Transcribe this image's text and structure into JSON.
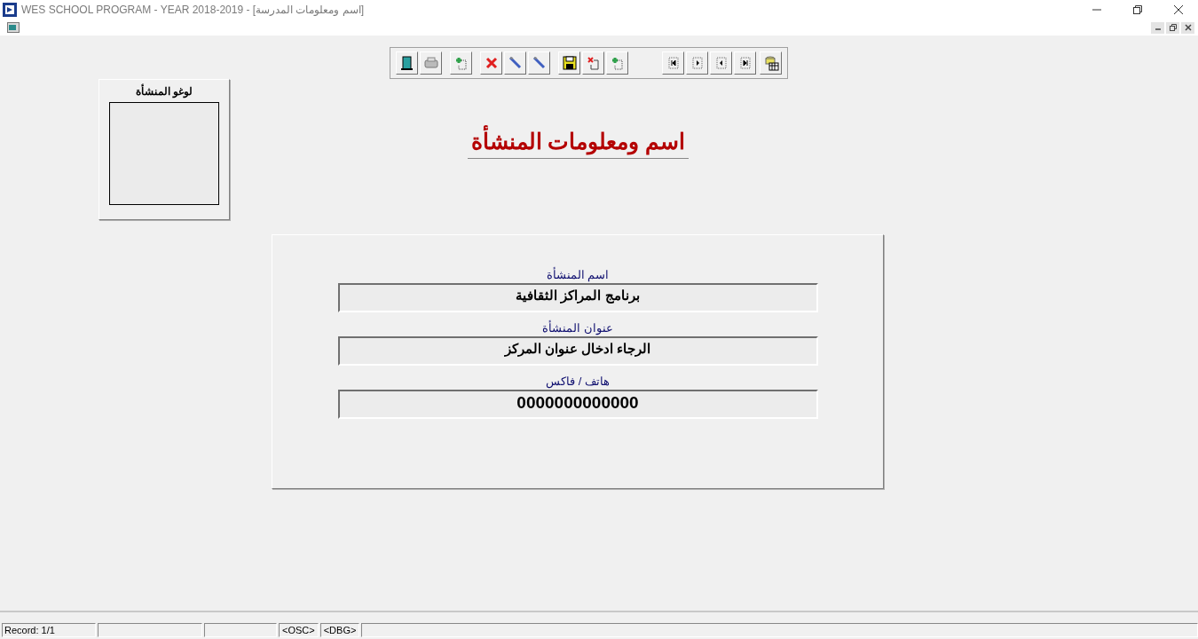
{
  "window": {
    "title": "WES SCHOOL PROGRAM - YEAR 2018-2019 - [اسم ومعلومات المدرسة]"
  },
  "toolbar": {
    "groups": [
      {
        "buttons": [
          {
            "kind": "exit"
          },
          {
            "kind": "print"
          }
        ]
      },
      {
        "buttons": [
          {
            "kind": "add"
          }
        ]
      },
      {
        "buttons": [
          {
            "kind": "delete"
          },
          {
            "kind": "edit"
          },
          {
            "kind": "edit-alt"
          }
        ]
      },
      {
        "buttons": [
          {
            "kind": "save"
          },
          {
            "kind": "cancel"
          },
          {
            "kind": "new"
          }
        ]
      },
      {
        "buttons": [
          {
            "kind": "first"
          },
          {
            "kind": "next"
          },
          {
            "kind": "prev"
          },
          {
            "kind": "last"
          }
        ]
      },
      {
        "buttons": [
          {
            "kind": "database"
          }
        ]
      }
    ]
  },
  "logo_panel": {
    "label": "لوغو المنشأة"
  },
  "heading": "اسم ومعلومات المنشأة",
  "fields": [
    {
      "label": "اسم المنشأة",
      "value": "برنامج المراكز الثقافية",
      "kind": "text"
    },
    {
      "label": "عنوان المنشأة",
      "value": "الرجاء ادخال عنوان المركز",
      "kind": "text"
    },
    {
      "label": "هاتف / فاكس",
      "value": "0000000000000",
      "kind": "number"
    }
  ],
  "status_bar": {
    "record": "Record: 1/1",
    "indicator_1": "<OSC>",
    "indicator_2": "<DBG>"
  }
}
